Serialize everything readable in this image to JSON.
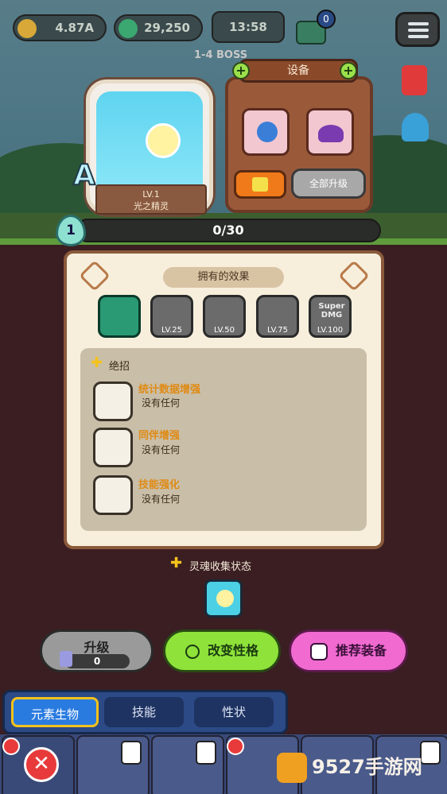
{
  "top": {
    "gold": "4.87A",
    "gems": "29,250",
    "timer": "13:58",
    "mail_badge": "0",
    "stage": "1-4 BOSS"
  },
  "character": {
    "rank": "A",
    "level": "LV.1",
    "name": "光之精灵"
  },
  "equipment": {
    "title": "设备",
    "upgrade_all": "全部升级"
  },
  "progress": {
    "level_badge": "1",
    "value": "0/30",
    "fraction": 0
  },
  "effects": {
    "title": "拥有的效果",
    "items": [
      {
        "name": "effect-crystal-sword",
        "label": ""
      },
      {
        "name": "effect-power",
        "label": "LV.25"
      },
      {
        "name": "effect-compass",
        "label": "LV.50"
      },
      {
        "name": "effect-heart",
        "label": "LV.75"
      },
      {
        "name": "effect-super-dmg",
        "label": "LV.100",
        "text": "Super DMG"
      }
    ]
  },
  "skills": {
    "title": "绝招",
    "items": [
      {
        "name": "统计数据增强",
        "desc": "没有任何"
      },
      {
        "name": "同伴增强",
        "desc": "没有任何"
      },
      {
        "name": "技能强化",
        "desc": "没有任何"
      }
    ]
  },
  "soul": {
    "title": "灵魂收集状态"
  },
  "actions": {
    "upgrade": "升级",
    "upgrade_cost": "0",
    "change_personality": "改变性格",
    "recommend_equipment": "推荐装备"
  },
  "tabs": [
    "元素生物",
    "技能",
    "性状"
  ],
  "watermark": "9527手游网",
  "colors": {
    "accent_green": "#8ee23a",
    "accent_pink": "#f06ad0",
    "tab_active": "#2a7be0",
    "skill_name": "#e08a14"
  }
}
